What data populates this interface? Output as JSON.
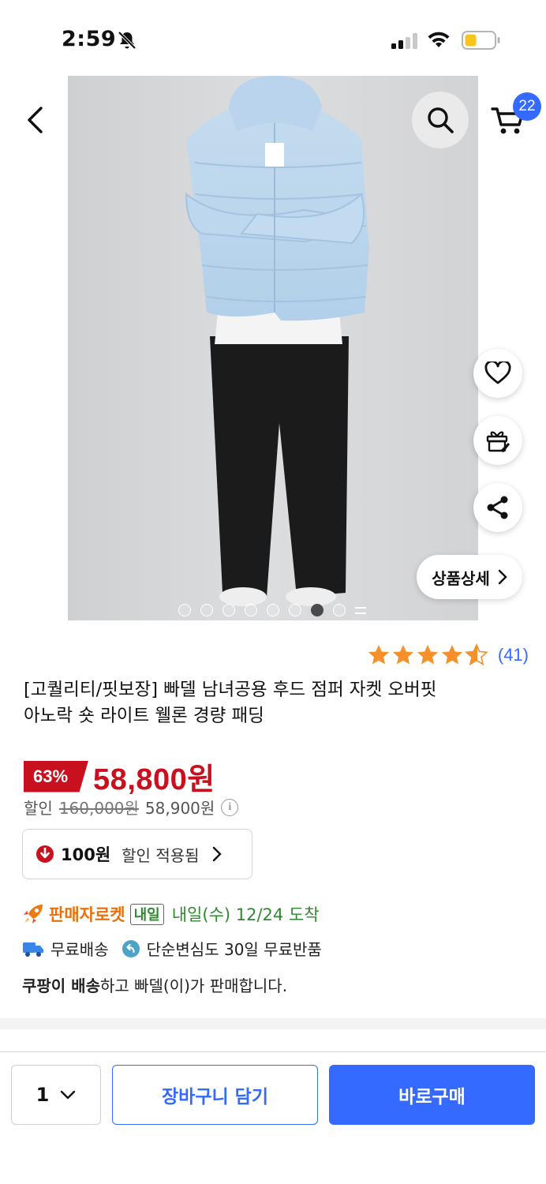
{
  "status_bar": {
    "time": "2:59"
  },
  "header": {
    "cart_count": "22"
  },
  "gallery": {
    "detail_button_label": "상품상세",
    "slide_count": 9,
    "active_slide_index": 6
  },
  "product": {
    "rating": 4.5,
    "rating_count": "(41)",
    "title_line1": "[고퀄리티/핏보장] 빠델 남녀공용 후드 점퍼 자켓 오버핏",
    "title_line2": "아노락 숏 라이트 웰론 경량 패딩",
    "discount": "63%",
    "sale_price": "58,800원",
    "sub_label": "할인",
    "original_price": "160,000원",
    "base_price": "58,900원",
    "info_icon_glyph": "i"
  },
  "coupon": {
    "amount": "100원",
    "text": "할인 적용됨"
  },
  "delivery": {
    "rocket_label": "판매자로켓",
    "tomorrow_badge": "내일",
    "arrival": "내일(수) 12/24 도착",
    "free_shipping": "무료배송",
    "free_return": "단순변심도 30일 무료반품",
    "seller_bold": "쿠팡이 배송",
    "seller_rest": "하고 빠델(이)가 판매합니다."
  },
  "bottom_bar": {
    "quantity": "1",
    "add_to_cart": "장바구니 담기",
    "buy_now": "바로구매"
  },
  "colors": {
    "accent": "#346aff",
    "sale_red": "#c8101e",
    "star": "#f5902a",
    "green": "#2f8a2f"
  }
}
